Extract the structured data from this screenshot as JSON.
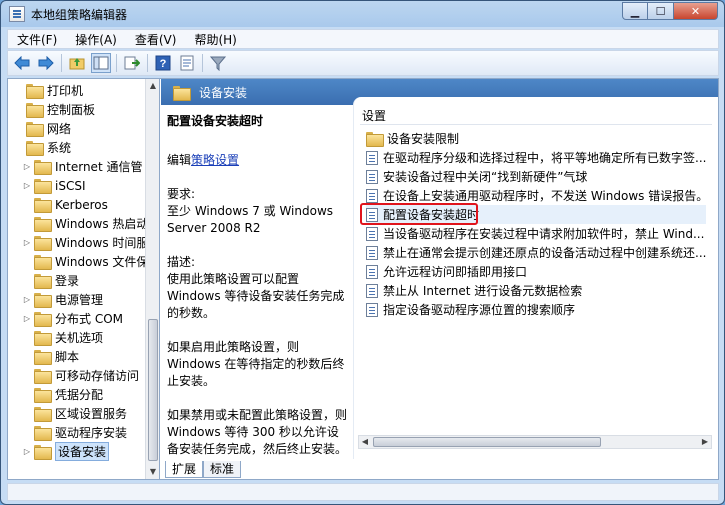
{
  "window": {
    "title": "本地组策略编辑器"
  },
  "menu": [
    "文件(F)",
    "操作(A)",
    "查看(V)",
    "帮助(H)"
  ],
  "toolbar": [
    "back-arrow-icon",
    "forward-arrow-icon",
    "up-folder-icon",
    "show-tree-icon",
    "export-icon",
    "help-icon",
    "properties-icon",
    "filter-icon"
  ],
  "tree": {
    "items": [
      {
        "label": "打印机",
        "indent": 0,
        "arrow": ""
      },
      {
        "label": "控制面板",
        "indent": 0,
        "arrow": ""
      },
      {
        "label": "网络",
        "indent": 0,
        "arrow": ""
      },
      {
        "label": "系统",
        "indent": 0,
        "arrow": ""
      },
      {
        "label": "Internet 通信管",
        "indent": 1,
        "arrow": "▷"
      },
      {
        "label": "iSCSI",
        "indent": 1,
        "arrow": "▷"
      },
      {
        "label": "Kerberos",
        "indent": 1,
        "arrow": ""
      },
      {
        "label": "Windows 热启动",
        "indent": 1,
        "arrow": ""
      },
      {
        "label": "Windows 时间服",
        "indent": 1,
        "arrow": "▷"
      },
      {
        "label": "Windows 文件保",
        "indent": 1,
        "arrow": ""
      },
      {
        "label": "登录",
        "indent": 1,
        "arrow": ""
      },
      {
        "label": "电源管理",
        "indent": 1,
        "arrow": "▷"
      },
      {
        "label": "分布式 COM",
        "indent": 1,
        "arrow": "▷"
      },
      {
        "label": "关机选项",
        "indent": 1,
        "arrow": ""
      },
      {
        "label": "脚本",
        "indent": 1,
        "arrow": ""
      },
      {
        "label": "可移动存储访问",
        "indent": 1,
        "arrow": ""
      },
      {
        "label": "凭据分配",
        "indent": 1,
        "arrow": ""
      },
      {
        "label": "区域设置服务",
        "indent": 1,
        "arrow": ""
      },
      {
        "label": "驱动程序安装",
        "indent": 1,
        "arrow": ""
      },
      {
        "label": "设备安装",
        "indent": 1,
        "arrow": "▷",
        "selected": true
      }
    ]
  },
  "header": {
    "title": "设备安装"
  },
  "description": {
    "title": "配置设备安装超时",
    "edit_prefix": "编辑",
    "edit_link": "策略设置",
    "requirements_label": "要求:",
    "requirements": "至少 Windows 7 或 Windows Server 2008 R2",
    "desc_label": "描述:",
    "desc": "使用此策略设置可以配置 Windows 等待设备安装任务完成的秒数。",
    "enabled": "如果启用此策略设置，则 Windows 在等待指定的秒数后终止安装。",
    "disabled": "如果禁用或未配置此策略设置，则 Windows 等待 300 秒以允许设备安装任务完成，然后终止安装。"
  },
  "settings": {
    "column": "设置",
    "items": [
      {
        "label": "设备安装限制",
        "icon": "folder"
      },
      {
        "label": "在驱动程序分级和选择过程中，将平等地确定所有已数字签...",
        "icon": "doc"
      },
      {
        "label": "安装设备过程中关闭“找到新硬件”气球",
        "icon": "doc"
      },
      {
        "label": "在设备上安装通用驱动程序时，不发送 Windows 错误报告。",
        "icon": "doc"
      },
      {
        "label": "配置设备安装超时",
        "icon": "doc",
        "highlighted": true
      },
      {
        "label": "当设备驱动程序在安装过程中请求附加软件时，禁止 Wind...",
        "icon": "doc"
      },
      {
        "label": "禁止在通常会提示创建还原点的设备活动过程中创建系统还...",
        "icon": "doc"
      },
      {
        "label": "允许远程访问即插即用接口",
        "icon": "doc"
      },
      {
        "label": "禁止从 Internet 进行设备元数据检索",
        "icon": "doc"
      },
      {
        "label": "指定设备驱动程序源位置的搜索顺序",
        "icon": "doc"
      }
    ]
  },
  "tabs": [
    "扩展",
    "标准"
  ],
  "colors": {
    "accent": "#3a6eb0",
    "highlight_box": "#e0141c"
  }
}
